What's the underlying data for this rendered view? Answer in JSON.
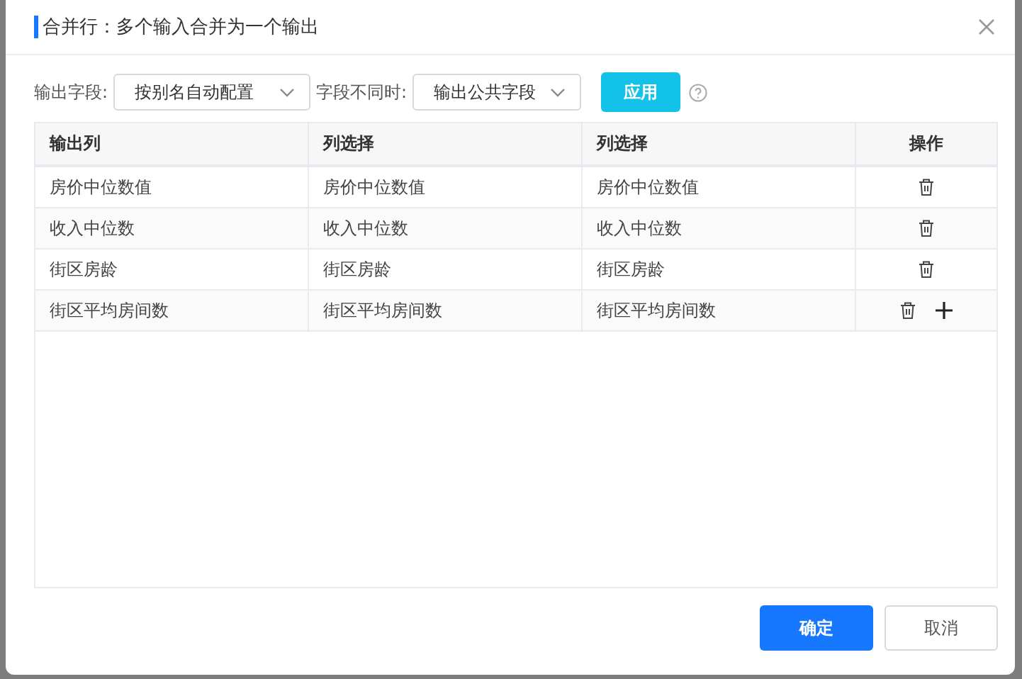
{
  "dialog": {
    "title": "合并行：多个输入合并为一个输出"
  },
  "toolbar": {
    "output_label": "输出字段:",
    "output_select": "按别名自动配置",
    "diff_label": "字段不同时:",
    "diff_select": "输出公共字段",
    "apply": "应用"
  },
  "table": {
    "columns": [
      "输出列",
      "列选择",
      "列选择",
      "操作"
    ],
    "rows": [
      {
        "cells": [
          "房价中位数值",
          "房价中位数值",
          "房价中位数值"
        ],
        "can_add": false
      },
      {
        "cells": [
          "收入中位数",
          "收入中位数",
          "收入中位数"
        ],
        "can_add": false
      },
      {
        "cells": [
          "街区房龄",
          "街区房龄",
          "街区房龄"
        ],
        "can_add": false
      },
      {
        "cells": [
          "街区平均房间数",
          "街区平均房间数",
          "街区平均房间数"
        ],
        "can_add": true
      }
    ]
  },
  "buttons": [
    {
      "label": "确定",
      "kind": "primary"
    },
    {
      "label": "取消",
      "kind": "default"
    }
  ]
}
